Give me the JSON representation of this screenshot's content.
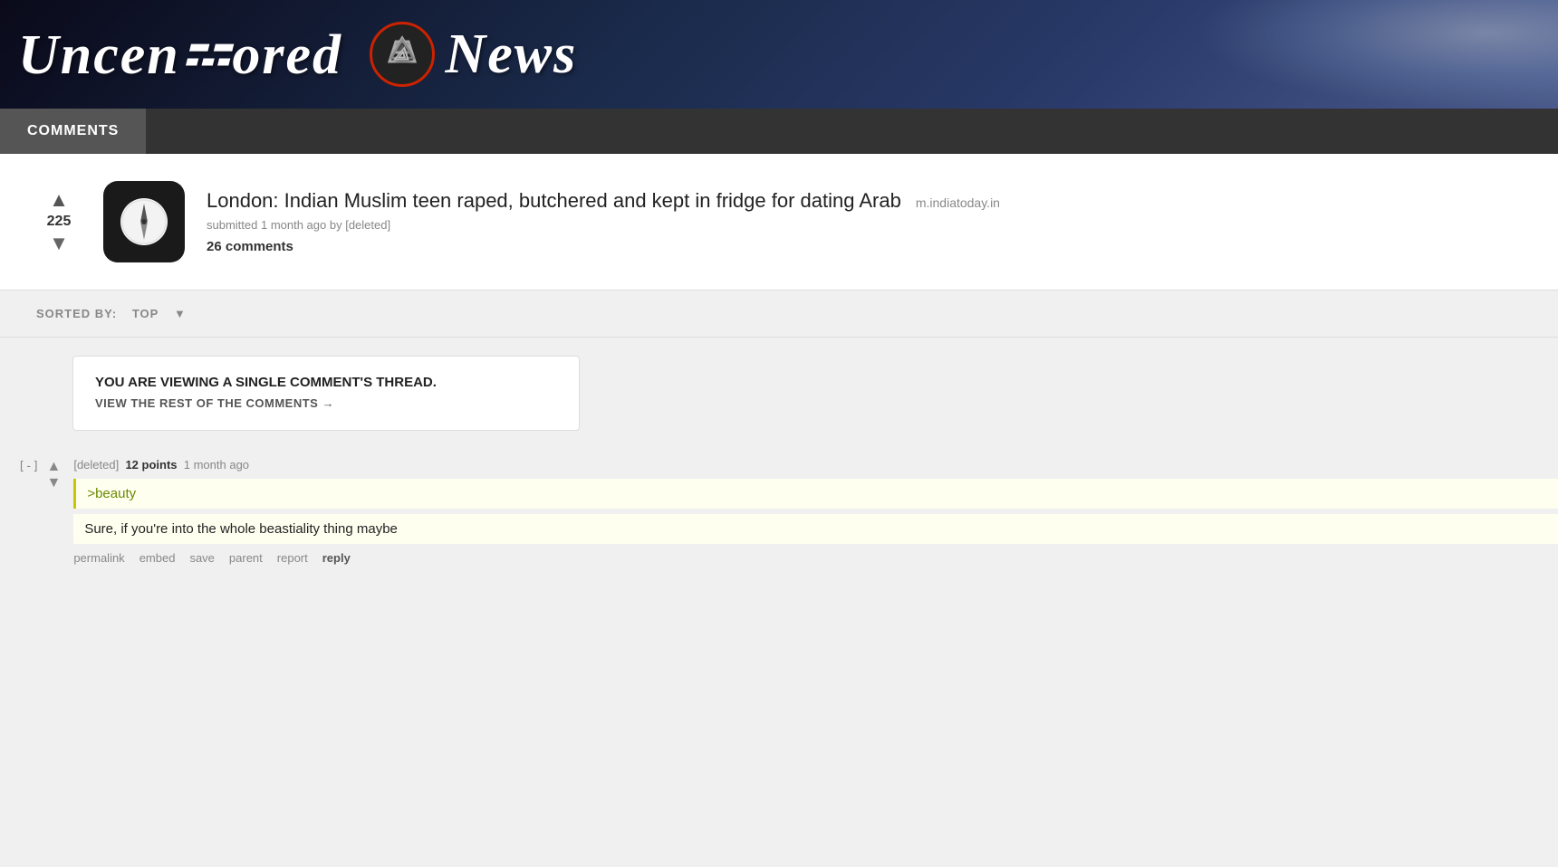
{
  "header": {
    "title_part1": "Uncen",
    "title_part2": "ored ",
    "title_part3": "News",
    "logo_alt": "Valknut logo"
  },
  "nav": {
    "comments_label": "COMMENTS"
  },
  "post": {
    "vote_up": "▲",
    "vote_count": "225",
    "vote_down": "▼",
    "title": "London: Indian Muslim teen raped, butchered and kept in fridge for dating Arab",
    "source": "m.indiatoday.in",
    "meta": "submitted 1 month ago by [deleted]",
    "comments_count": "26 comments"
  },
  "sort": {
    "label": "SORTED BY:",
    "value": "TOP",
    "arrow": "▼"
  },
  "thread_notice": {
    "title": "YOU ARE VIEWING A SINGLE COMMENT'S THREAD.",
    "link": "VIEW THE REST OF THE COMMENTS →"
  },
  "comment": {
    "collapse": "[-]",
    "vote_up": "▲",
    "vote_down": "▼",
    "author": "[deleted]",
    "points": "12 points",
    "time": "1 month ago",
    "quote": ">beauty",
    "text": "Sure, if you're into the whole beastiality thing maybe",
    "actions": {
      "permalink": "permalink",
      "embed": "embed",
      "save": "save",
      "parent": "parent",
      "report": "report",
      "reply": "reply"
    }
  }
}
